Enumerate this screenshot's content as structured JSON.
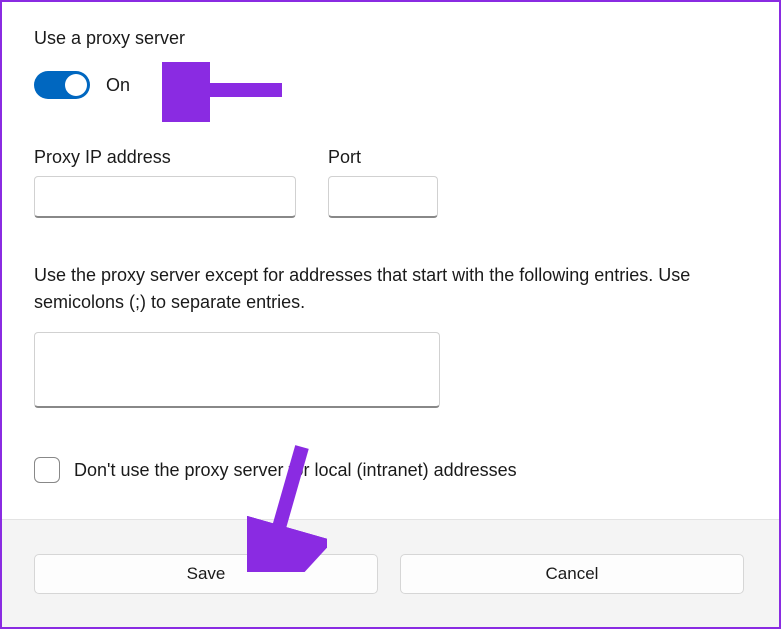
{
  "header": {
    "title": "Use a proxy server"
  },
  "toggle": {
    "state_label": "On"
  },
  "fields": {
    "ip_label": "Proxy IP address",
    "ip_value": "",
    "port_label": "Port",
    "port_value": ""
  },
  "exceptions": {
    "description": "Use the proxy server except for addresses that start with the following entries. Use semicolons (;) to separate entries.",
    "value": ""
  },
  "local_bypass": {
    "label": "Don't use the proxy server for local (intranet) addresses"
  },
  "buttons": {
    "save": "Save",
    "cancel": "Cancel"
  },
  "annotations": {
    "arrow_color": "#8a2be2"
  }
}
